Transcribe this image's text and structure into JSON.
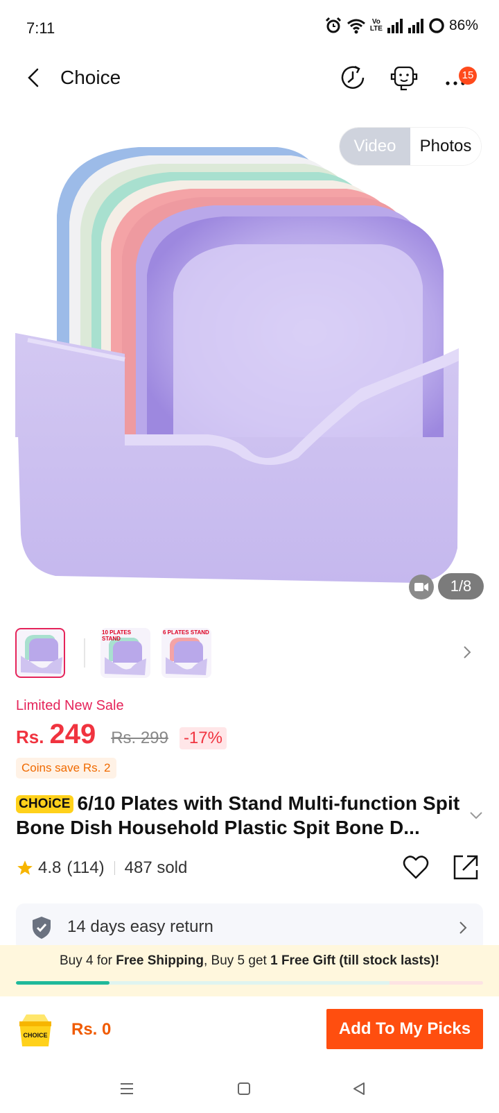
{
  "status_bar": {
    "time": "7:11",
    "battery": "86%",
    "network_badge": [
      "Vo",
      "LTE"
    ]
  },
  "header": {
    "title": "Choice",
    "notification_count": "15"
  },
  "gallery": {
    "toggle": {
      "video": "Video",
      "photos": "Photos"
    },
    "counter": "1/8",
    "thumbnails": [
      {
        "tag": ""
      },
      {
        "tag": "10 PLATES STAND"
      },
      {
        "tag": "6 PLATES STAND"
      }
    ]
  },
  "pricing": {
    "sale_label": "Limited New Sale",
    "currency": "Rs.",
    "price": "249",
    "original_price": "Rs. 299",
    "discount": "-17%",
    "coins": "Coins save Rs. 2"
  },
  "product": {
    "choice_tag": "CHOiCE",
    "title": "6/10 Plates with Stand Multi-function Spit Bone Dish Household Plastic Spit Bone D..."
  },
  "rating": {
    "score": "4.8",
    "count": "(114)",
    "sold": "487 sold"
  },
  "services": {
    "return_text": "14 days easy return"
  },
  "promo": {
    "part1": "Buy 4 for ",
    "bold1": "Free Shipping",
    "part2": ", Buy 5 get ",
    "bold2": "1 Free Gift (till stock lasts)!",
    "progress_fraction": 0.2
  },
  "bottom_bar": {
    "cart_label": "CHOICE",
    "total": "Rs. 0",
    "add_button": "Add To My Picks"
  },
  "colors": {
    "accent_red": "#f0333f",
    "button_orange": "#ff4e0f",
    "choice_yellow": "#ffd11b"
  }
}
